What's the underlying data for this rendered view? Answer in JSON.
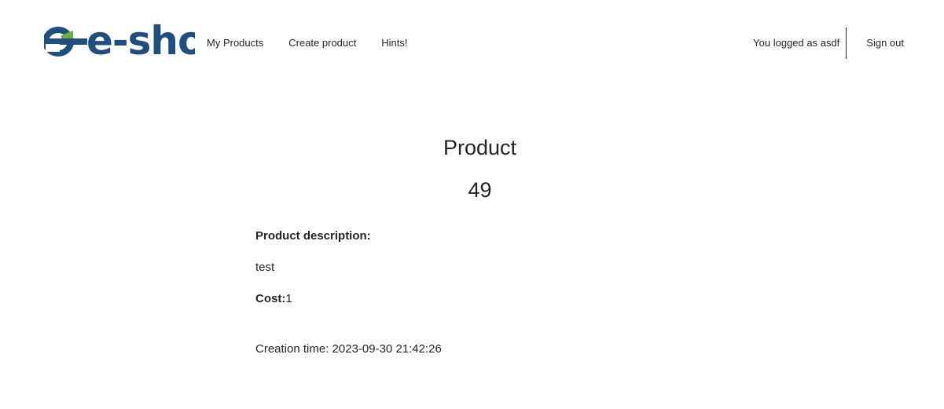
{
  "brand": {
    "logo_text": "e-shop",
    "primary_color": "#1f4e80",
    "accent_color": "#6bb23a"
  },
  "nav": {
    "items": [
      {
        "label": "My Products"
      },
      {
        "label": "Create product"
      },
      {
        "label": "Hints!"
      }
    ]
  },
  "user": {
    "logged_as": "You logged as asdf",
    "sign_out_label": "Sign out"
  },
  "product": {
    "heading": "Product",
    "id": "49",
    "description_label": "Product description:",
    "description": "test",
    "cost_label": "Cost:",
    "cost": "1",
    "creation_label": "Creation time: ",
    "creation_time": "2023-09-30 21:42:26"
  }
}
